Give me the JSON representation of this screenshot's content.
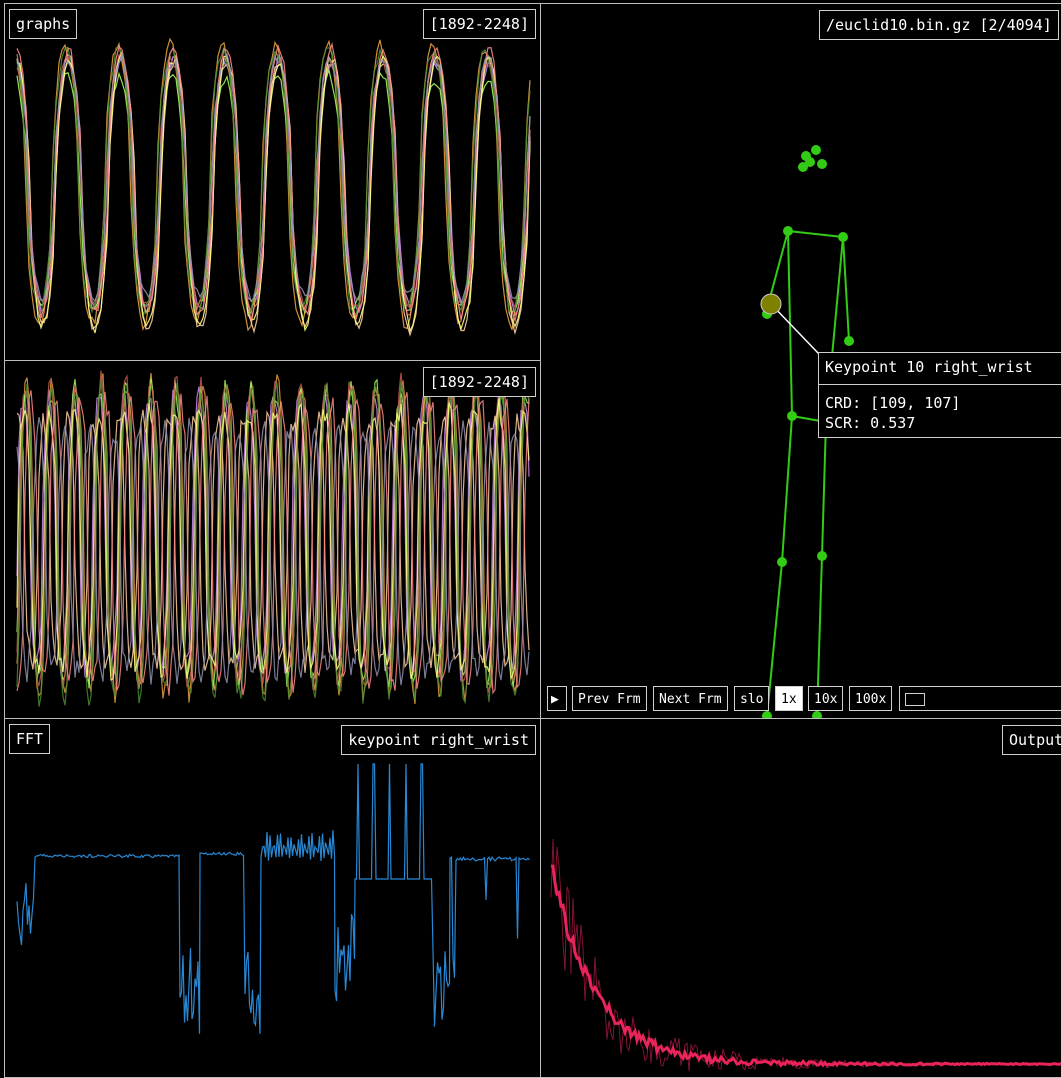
{
  "panels": {
    "graphs_label": "graphs",
    "top_range": "[1892-2248]",
    "mid_range": "[1892-2248]",
    "fft_label": "FFT",
    "keypoint_label": "keypoint right_wrist",
    "file_label": "/euclid10.bin.gz [2/4094]",
    "output_label": "Output"
  },
  "tooltip": {
    "title": "Keypoint 10 right_wrist",
    "crd": "CRD: [109, 107]",
    "scr": "SCR: 0.537"
  },
  "controls": {
    "play": "▶",
    "prev": "Prev Frm",
    "next": "Next Frm",
    "slo": "slo",
    "x1": "1x",
    "x10": "10x",
    "x100": "100x",
    "selected_speed": "1x"
  },
  "colors": {
    "skeleton": "#33cc14",
    "selected_keypoint": "#808000",
    "fft": "#2a8fe0",
    "output": "#e8245a",
    "series": [
      "#d28cf0",
      "#e8a040",
      "#a0ff60",
      "#ffd0a0",
      "#c05a50",
      "#4c8c30",
      "#ffff80",
      "#ff8888",
      "#9090b0"
    ]
  }
}
